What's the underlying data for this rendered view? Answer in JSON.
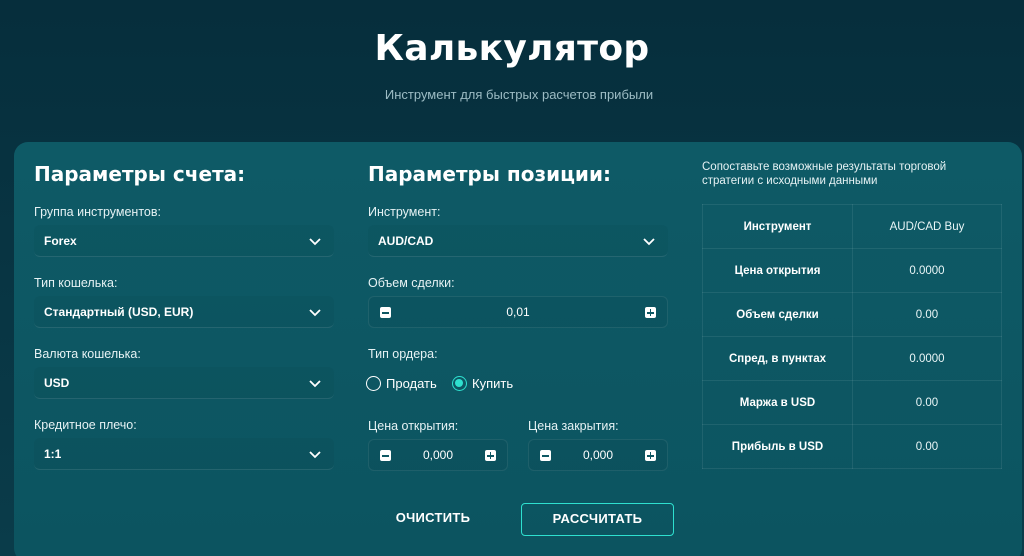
{
  "header": {
    "title": "Калькулятор",
    "subtitle": "Инструмент для быстрых расчетов прибыли"
  },
  "account": {
    "title": "Параметры счета:",
    "instrument_group": {
      "label": "Группа инструментов:",
      "value": "Forex"
    },
    "wallet_type": {
      "label": "Тип кошелька:",
      "value": "Стандартный (USD, EUR)"
    },
    "wallet_currency": {
      "label": "Валюта кошелька:",
      "value": "USD"
    },
    "leverage": {
      "label": "Кредитное плечо:",
      "value": "1:1"
    }
  },
  "position": {
    "title": "Параметры позиции:",
    "instrument": {
      "label": "Инструмент:",
      "value": "AUD/CAD"
    },
    "volume": {
      "label": "Объем сделки:",
      "value": "0,01"
    },
    "order_type": {
      "label": "Тип ордера:",
      "options": [
        "Продать",
        "Купить"
      ],
      "selected": "Купить"
    },
    "open_price": {
      "label": "Цена открытия:",
      "value": "0,000"
    },
    "close_price": {
      "label": "Цена закрытия:",
      "value": "0,000"
    }
  },
  "results": {
    "note": "Сопоставьте возможные результаты торговой стратегии с исходными данными",
    "rows": [
      {
        "key": "Инструмент",
        "value": "AUD/CAD Buy"
      },
      {
        "key": "Цена открытия",
        "value": "0.0000"
      },
      {
        "key": "Объем сделки",
        "value": "0.00"
      },
      {
        "key": "Спред, в пунктах",
        "value": "0.0000"
      },
      {
        "key": "Маржа в USD",
        "value": "0.00"
      },
      {
        "key": "Прибыль в USD",
        "value": "0.00"
      }
    ]
  },
  "actions": {
    "clear_label": "ОЧИСТИТЬ",
    "calculate_label": "РАССЧИТАТЬ"
  },
  "colors": {
    "background": "#062e3c",
    "card": "#0e5a66",
    "accent": "#2ee0cf"
  }
}
